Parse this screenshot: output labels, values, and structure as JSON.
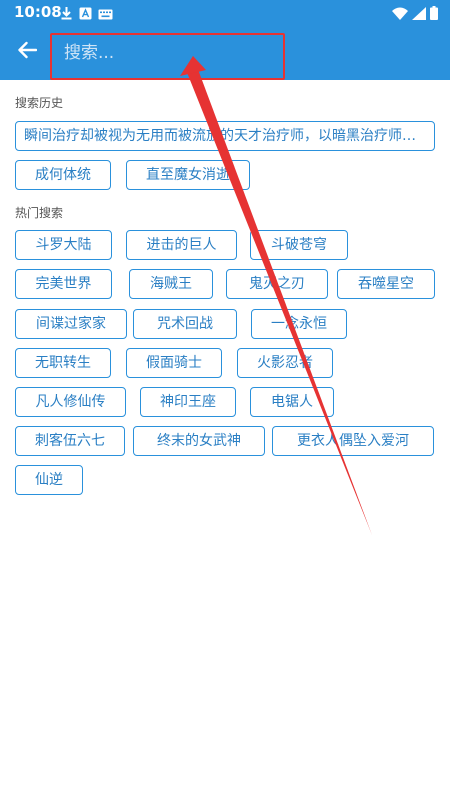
{
  "status_bar": {
    "time": "10:08",
    "colors": {
      "bar": "#2a91dc"
    },
    "left_icons": [
      "download-icon",
      "app-notification-icon",
      "keyboard-icon"
    ],
    "right_icons": [
      "wifi-icon",
      "signal-icon",
      "battery-icon"
    ]
  },
  "toolbar": {
    "back_icon": "arrow-left-icon",
    "search_placeholder": "搜索...",
    "search_value": ""
  },
  "history": {
    "title": "搜索历史",
    "items": [
      "瞬间治疗却被视为无用而被流放的天才治疗师，以暗黑治疗师身份肆意生活",
      "成何体统",
      "直至魔女消逝"
    ]
  },
  "hot": {
    "title": "热门搜索",
    "items": [
      "斗罗大陆",
      "进击的巨人",
      "斗破苍穹",
      "完美世界",
      "海贼王",
      "鬼灭之刃",
      "吞噬星空",
      "间谍过家家",
      "咒术回战",
      "一念永恒",
      "无职转生",
      "假面骑士",
      "火影忍者",
      "凡人修仙传",
      "神印王座",
      "电锯人",
      "刺客伍六七",
      "终末的女武神",
      "更衣人偶坠入爱河",
      "仙逆"
    ]
  },
  "colors": {
    "primary": "#2a91dc",
    "tag_text": "#2a7fc4",
    "annotation": "#e63333"
  }
}
